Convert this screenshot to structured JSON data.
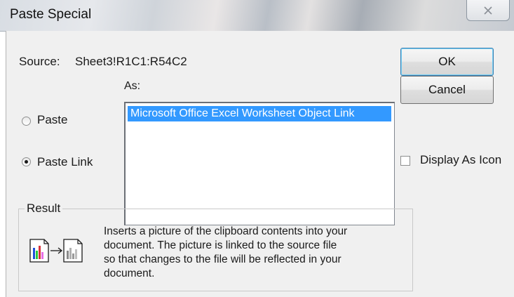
{
  "window": {
    "title": "Paste Special",
    "close_icon": "close-x-icon"
  },
  "source": {
    "label": "Source:",
    "value": "Sheet3!R1C1:R54C2"
  },
  "as_label": "As:",
  "paste_options": [
    {
      "label": "Paste",
      "selected": false
    },
    {
      "label": "Paste Link",
      "selected": true
    }
  ],
  "as_list": {
    "items": [
      "Microsoft Office Excel Worksheet Object Link"
    ],
    "selected_index": 0
  },
  "buttons": {
    "ok": "OK",
    "cancel": "Cancel"
  },
  "display_as_icon": {
    "label": "Display As Icon",
    "checked": false
  },
  "result": {
    "legend": "Result",
    "icon": "paste-link-picture-icon",
    "lines": [
      "Inserts a picture of the clipboard contents into your",
      "document.  The picture is linked to the source file",
      "so that changes to the file will be reflected in your",
      "document."
    ]
  },
  "colors": {
    "selection": "#3399ff",
    "dialog_bg": "#f0f0f0"
  }
}
